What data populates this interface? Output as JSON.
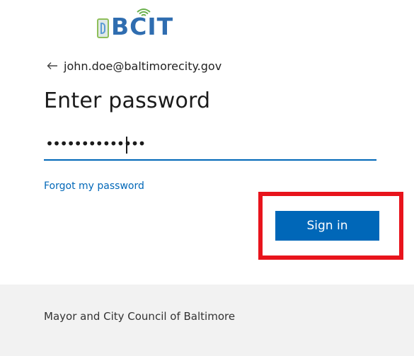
{
  "branding": {
    "logo_text": "BCIT",
    "logo_icon": "bcit-logo-with-wifi-signal"
  },
  "identity": {
    "back_icon": "left-arrow-icon",
    "email": "john.doe@baltimorecity.gov"
  },
  "form": {
    "title": "Enter password",
    "password_masked": "••••••••••••••",
    "forgot_link": "Forgot my password",
    "submit_label": "Sign in"
  },
  "footer": {
    "text": "Mayor and City Council of Baltimore"
  },
  "colors": {
    "accent": "#0067b8",
    "highlight": "#e8141c",
    "footer_bg": "#f2f2f2"
  }
}
